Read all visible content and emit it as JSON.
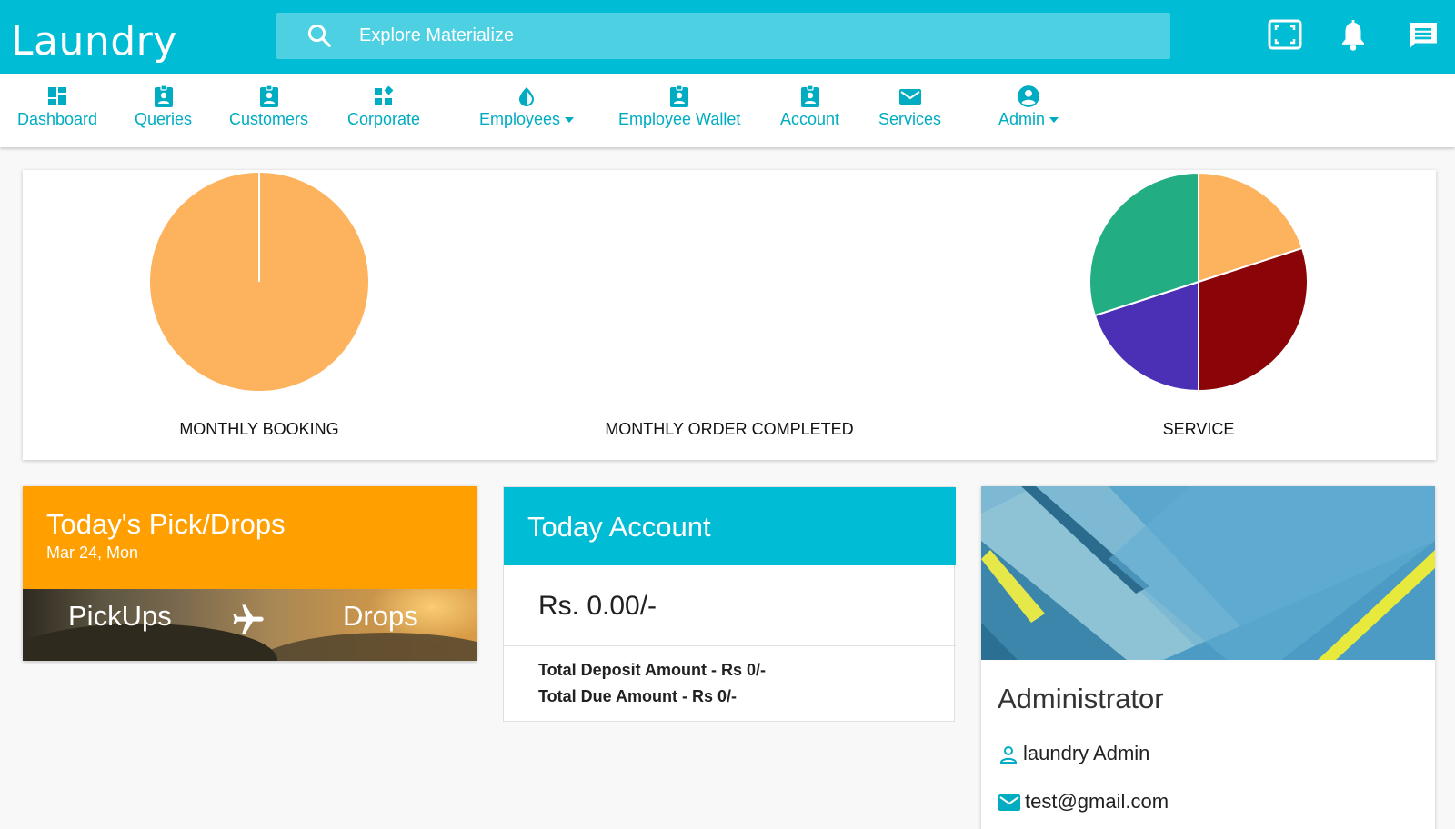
{
  "header": {
    "brand": "Laundry",
    "search_placeholder": "Explore Materialize",
    "icons": [
      "fullscreen-icon",
      "bell-icon",
      "chat-icon"
    ]
  },
  "nav": {
    "items": [
      {
        "label": "Dashboard",
        "icon": "dashboard-icon"
      },
      {
        "label": "Queries",
        "icon": "badge-icon"
      },
      {
        "label": "Customers",
        "icon": "badge-icon"
      },
      {
        "label": "Corporate",
        "icon": "widgets-icon"
      },
      {
        "label": "Employees",
        "icon": "drop-icon",
        "dropdown": true
      },
      {
        "label": "Employee Wallet",
        "icon": "badge-icon"
      },
      {
        "label": "Account",
        "icon": "badge-icon"
      },
      {
        "label": "Services",
        "icon": "mail-icon"
      },
      {
        "label": "Admin",
        "icon": "account-circle-icon",
        "dropdown": true
      }
    ]
  },
  "charts": {
    "labels": {
      "monthly_booking": "MONTHLY BOOKING",
      "monthly_order_completed": "MONTHLY ORDER COMPLETED",
      "service": "SERVICE"
    }
  },
  "chart_data": [
    {
      "type": "pie",
      "title": "MONTHLY BOOKING",
      "slices": [
        {
          "value": 1,
          "color": "#fdb25e"
        }
      ]
    },
    {
      "type": "pie",
      "title": "MONTHLY ORDER COMPLETED",
      "slices": []
    },
    {
      "type": "pie",
      "title": "SERVICE",
      "slices": [
        {
          "value": 0.2,
          "color": "#fdb25e"
        },
        {
          "value": 0.3,
          "color": "#8b0508"
        },
        {
          "value": 0.2,
          "color": "#4b2fb5"
        },
        {
          "value": 0.3,
          "color": "#22ad82"
        }
      ]
    }
  ],
  "pickdrops": {
    "title": "Today's Pick/Drops",
    "date": "Mar 24, Mon",
    "pickups_label": "PickUps",
    "drops_label": "Drops"
  },
  "account": {
    "title": "Today Account",
    "amount": "Rs. 0.00/-",
    "deposit": "Total Deposit Amount - Rs 0/-",
    "due": "Total Due Amount - Rs 0/-"
  },
  "admin": {
    "role": "Administrator",
    "name": "laundry Admin",
    "email": "test@gmail.com"
  },
  "colors": {
    "primary": "#00bcd4",
    "search_bg": "#4dd0e1",
    "orange": "#ff9f00",
    "nav_text": "#00acc1"
  }
}
